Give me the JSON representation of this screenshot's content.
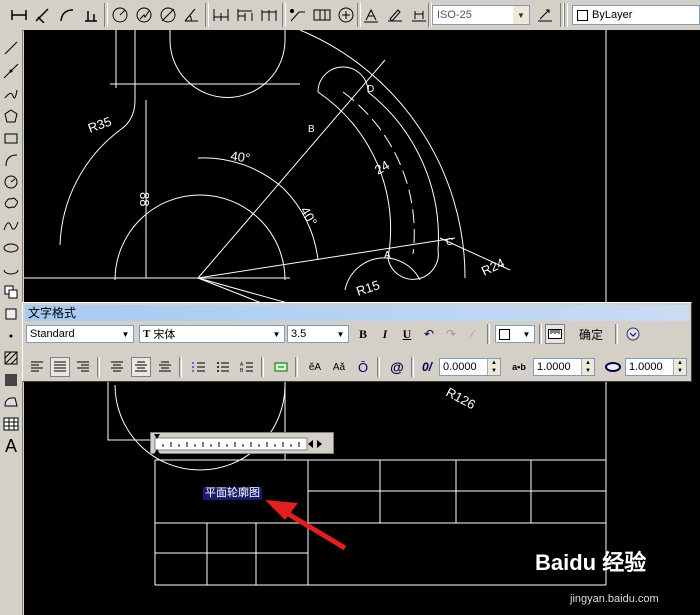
{
  "toolbar": {
    "icons": [
      "line-icon",
      "arc-dim-icon",
      "arc-icon",
      "dim-icon",
      "radius-icon",
      "diameter-icon",
      "angle-icon",
      "center-icon",
      "baseline-icon",
      "continue-icon",
      "quick-dim-icon",
      "tolerance-icon",
      "center-mark-icon",
      "dim-text-icon",
      "dim-edit-icon",
      "dim-style-icon"
    ],
    "dim_style_value": "ISO-25",
    "layer_value": "ByLayer"
  },
  "left_toolbar": {
    "tools": [
      "line-tool",
      "construction-line-tool",
      "polyline-tool",
      "polygon-tool",
      "rectangle-tool",
      "arc-tool",
      "circle-tool",
      "revision-cloud-tool",
      "spline-tool",
      "ellipse-tool",
      "ellipse-arc-tool",
      "insert-block-tool",
      "make-block-tool",
      "point-tool",
      "hatch-tool",
      "gradient-tool",
      "region-tool",
      "table-tool",
      "mtext-tool"
    ],
    "mtext_glyph": "A"
  },
  "drawing": {
    "labels": {
      "r35": "R35",
      "d88": "88",
      "angle1": "40°",
      "angle2": "40°",
      "dim24": "24",
      "pt_a": "A",
      "pt_b": "B",
      "pt_c": "C",
      "pt_d": "D",
      "r24": "R24",
      "r15": "R15",
      "r126": "R126"
    },
    "title_text": "平面轮廓图"
  },
  "text_format": {
    "title": "文字格式",
    "style_value": "Standard",
    "font_value": "宋体",
    "font_prefix": "T",
    "height_value": "3.5",
    "bold": "B",
    "italic": "I",
    "underline": "U",
    "ok_label": "确定",
    "oblique_value": "0.0000",
    "tracking_value": "1.0000",
    "width_value": "1.0000",
    "tracking_icon": "a•b",
    "at_icon": "@",
    "oblique_icon": "0/"
  },
  "watermark": {
    "brand": "Baidu 经验",
    "url": "jingyan.baidu.com"
  }
}
